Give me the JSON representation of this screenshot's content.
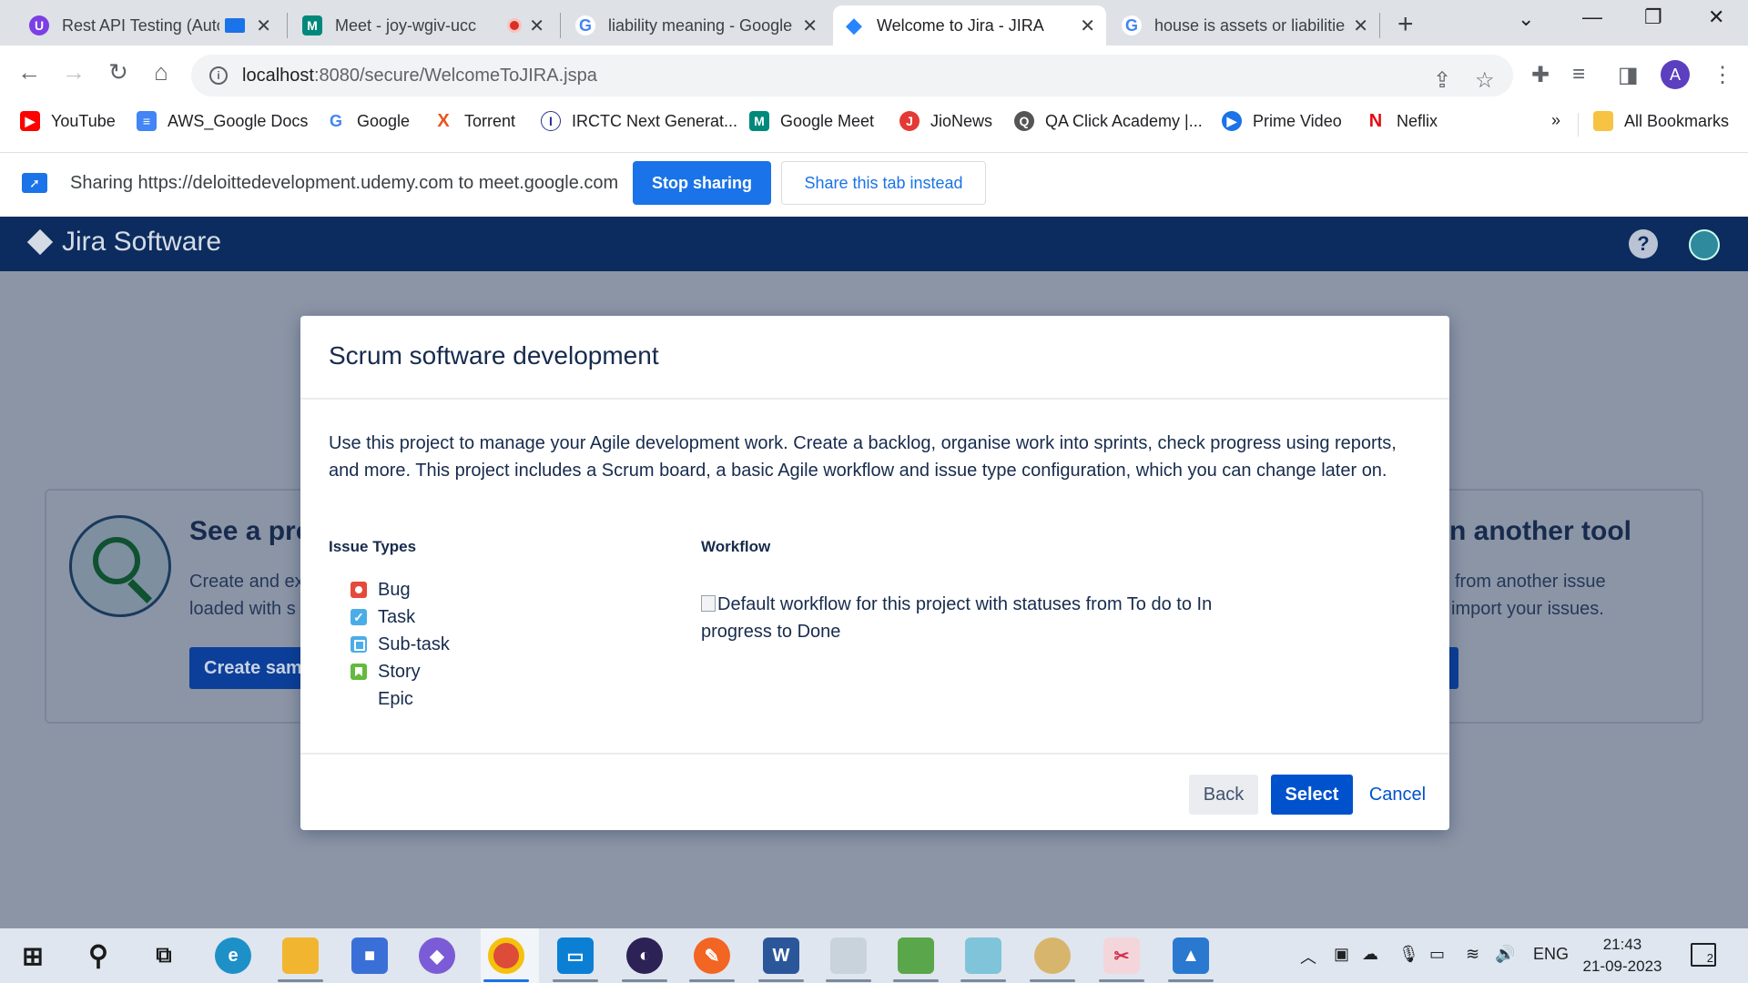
{
  "browser": {
    "tabs": [
      {
        "title": "Rest API Testing (Auto",
        "favicon_color": "#7b3fe4",
        "favicon_glyph": "U"
      },
      {
        "title": "Meet - joy-wgiv-ucc",
        "favicon_color": "#00897b",
        "favicon_glyph": "M"
      },
      {
        "title": "liability meaning - Google",
        "favicon_color": "#4285f4",
        "favicon_glyph": "G"
      },
      {
        "title": "Welcome to Jira - JIRA",
        "favicon_color": "#2684ff",
        "favicon_glyph": "◆"
      },
      {
        "title": "house is assets or liabilities",
        "favicon_color": "#4285f4",
        "favicon_glyph": "G"
      }
    ],
    "url_host": "localhost",
    "url_path": ":8080/secure/WelcomeToJIRA.jspa",
    "profile_initial": "A",
    "bookmarks": [
      {
        "label": "YouTube",
        "icon_color": "#ff0000",
        "glyph": "▶"
      },
      {
        "label": "AWS_Google Docs",
        "icon_color": "#4285f4",
        "glyph": "≡"
      },
      {
        "label": "Google",
        "icon_color": "#4285f4",
        "glyph": "G"
      },
      {
        "label": "Torrent",
        "icon_color": "#e8541e",
        "glyph": "X"
      },
      {
        "label": "IRCTC Next Generat...",
        "icon_color": "#283593",
        "glyph": "I"
      },
      {
        "label": "Google Meet",
        "icon_color": "#00897b",
        "glyph": "M"
      },
      {
        "label": "JioNews",
        "icon_color": "#e53935",
        "glyph": "J"
      },
      {
        "label": "QA Click Academy |...",
        "icon_color": "#555555",
        "glyph": "Q"
      },
      {
        "label": "Prime Video",
        "icon_color": "#1a73e8",
        "glyph": "▶"
      },
      {
        "label": "Neflix",
        "icon_color": "#e50914",
        "glyph": "N"
      }
    ],
    "all_bookmarks_label": "All Bookmarks",
    "more_bookmarks": "»"
  },
  "sharing_bar": {
    "text": "Sharing https://deloittedevelopment.udemy.com to meet.google.com",
    "stop_label": "Stop sharing",
    "share_tab_label": "Share this tab instead"
  },
  "jira": {
    "brand": "Jira Software",
    "background": {
      "left_heading": "See a pro",
      "left_text_1": "Create and ex",
      "left_text_2": "loaded with s",
      "left_button": "Create sam",
      "right_heading": "n another tool",
      "right_text_1": "from another issue",
      "right_text_2": "import your issues."
    },
    "modal": {
      "title": "Scrum software development",
      "description": "Use this project to manage your Agile development work. Create a backlog, organise work into sprints, check progress using reports, and more. This project includes a Scrum board, a basic Agile workflow and issue type configuration, which you can change later on.",
      "issue_types_label": "Issue Types",
      "issue_types": [
        "Bug",
        "Task",
        "Sub-task",
        "Story",
        "Epic"
      ],
      "workflow_label": "Workflow",
      "workflow_alt": "Default workflow for this project with statuses from To do to In progress to Done",
      "back_label": "Back",
      "select_label": "Select",
      "cancel_label": "Cancel"
    }
  },
  "taskbar": {
    "language": "ENG",
    "time": "21:43",
    "date": "21-09-2023",
    "notification_count": "2"
  }
}
